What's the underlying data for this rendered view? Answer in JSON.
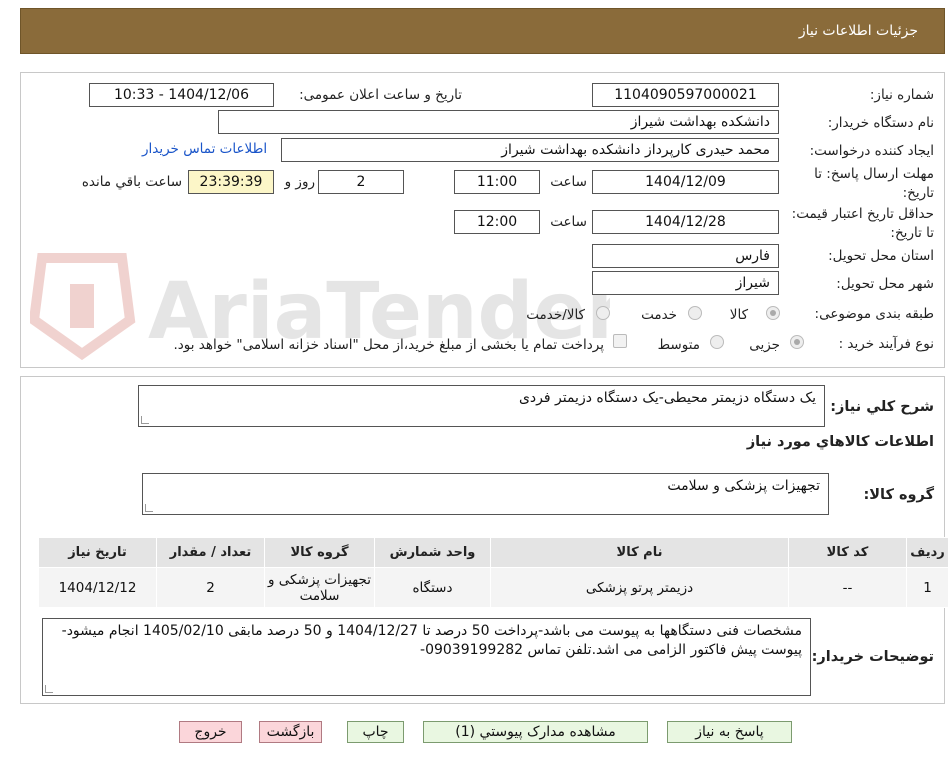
{
  "header": {
    "title": "جزئیات اطلاعات نیاز"
  },
  "labels": {
    "need_number": "شماره نیاز:",
    "announce_datetime": "تاریخ و ساعت اعلان عمومی:",
    "buyer_org": "نام دستگاه خریدار:",
    "requester": "ایجاد کننده درخواست:",
    "contact_link": "اطلاعات تماس خریدار",
    "reply_deadline": "مهلت ارسال پاسخ: تا تاریخ:",
    "hour": "ساعت",
    "day_and": "روز و",
    "remaining": "ساعت باقي مانده",
    "price_validity": "حداقل تاریخ اعتبار قیمت: تا تاریخ:",
    "province": "استان محل تحویل:",
    "city": "شهر محل تحویل:",
    "category": "طبقه بندی موضوعی:",
    "process_type": "نوع فرآیند خرید :",
    "summary": "شرح کلي نياز:",
    "goods_info": "اطلاعات کالاهاي مورد نياز",
    "goods_group": "گروه کالا:",
    "buyer_notes": "توضیحات خریدار:"
  },
  "fields": {
    "need_number": "1104090597000021",
    "announce_datetime": "1404/12/06 - 10:33",
    "buyer_org": "دانشکده بهداشت شیراز",
    "requester": "محمد حیدری کارپرداز دانشکده بهداشت شیراز",
    "reply_date": "1404/12/09",
    "reply_time": "11:00",
    "reply_days": "2",
    "reply_remaining": "23:39:39",
    "validity_date": "1404/12/28",
    "validity_time": "12:00",
    "province": "فارس",
    "city": "شیراز"
  },
  "category_options": [
    {
      "label": "کالا",
      "checked": true
    },
    {
      "label": "خدمت",
      "checked": false
    },
    {
      "label": "کالا/خدمت",
      "checked": false
    }
  ],
  "process_options": [
    {
      "label": "جزیی",
      "checked": true
    },
    {
      "label": "متوسط",
      "checked": false
    }
  ],
  "treasury_note": "پرداخت تمام یا بخشی از مبلغ خرید،از محل \"اسناد خزانه اسلامی\" خواهد بود.",
  "summary_text": "یک دستگاه دزیمتر محیطی-یک دستگاه دزیمتر فردی",
  "goods_group_text": "تجهیزات پزشکی و سلامت",
  "table": {
    "headers": [
      "ردیف",
      "کد کالا",
      "نام کالا",
      "واحد شمارش",
      "گروه کالا",
      "تعداد / مقدار",
      "تاریخ نیاز"
    ],
    "rows": [
      [
        "1",
        "--",
        "دزیمتر پرتو پزشکی",
        "دستگاه",
        "تجهیزات پزشکی و سلامت",
        "2",
        "1404/12/12"
      ]
    ]
  },
  "buyer_notes_text": "مشخصات فنی دستگاهها به پیوست می باشد-پرداخت 50 درصد تا 1404/12/27 و 50 درصد مابقی 1405/02/10 انجام میشود-پیوست پیش فاکتور الزامی می اشد.تلفن تماس 09039199282-",
  "buttons": {
    "reply": "پاسخ به نیاز",
    "attachments": "مشاهده مدارک پیوستي (1)",
    "print": "چاپ",
    "back": "بازگشت",
    "exit": "خروج"
  },
  "watermark": "AriaTender.neT",
  "colors": {
    "header": "#8a6b3a",
    "link": "#1a55c9",
    "button_green": "#e9f7e1",
    "button_pink": "#fbd6da",
    "remaining_bg": "#fcf6c8"
  }
}
